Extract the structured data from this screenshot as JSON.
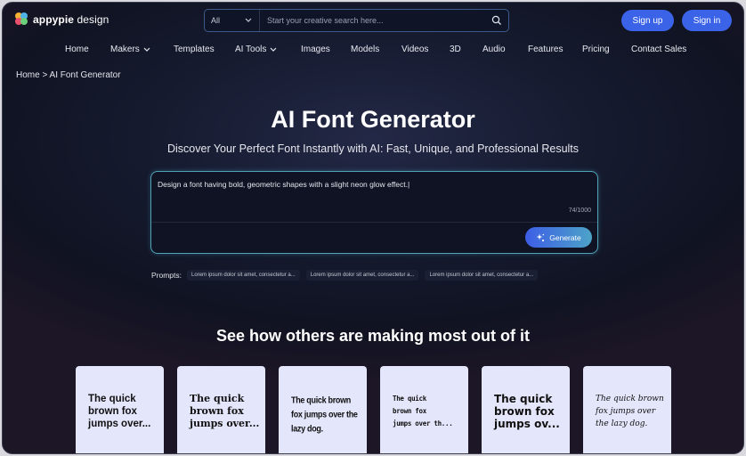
{
  "header": {
    "logo_brand": "appypie",
    "logo_suffix": " design",
    "search": {
      "category": "All",
      "placeholder": "Start your creative search here..."
    },
    "signup_label": "Sign up",
    "signin_label": "Sign in"
  },
  "nav": {
    "items": [
      {
        "label": "Home"
      },
      {
        "label": "Makers"
      },
      {
        "label": "Templates"
      },
      {
        "label": "AI Tools"
      },
      {
        "label": "Images"
      },
      {
        "label": "Models"
      },
      {
        "label": "Videos"
      },
      {
        "label": "3D"
      },
      {
        "label": "Audio"
      },
      {
        "label": "Features"
      },
      {
        "label": "Pricing"
      },
      {
        "label": "Contact Sales"
      }
    ]
  },
  "breadcrumb": "Home > AI Font Generator",
  "hero": {
    "title": "AI Font Generator",
    "subtitle": "Discover Your Perfect Font Instantly with AI: Fast, Unique, and Professional Results"
  },
  "prompt": {
    "value": "Design a font having bold, geometric shapes with a slight neon glow effect.|",
    "counter": "74/1000",
    "generate_label": "Generate"
  },
  "prompts": {
    "label": "Prompts:",
    "chips": [
      "Lorem ipsum dolor sit amet, consectetur a...",
      "Lorem ipsum dolor sit amet, consectetur a...",
      "Lorem ipsum dolor sit amet, consectetur a..."
    ]
  },
  "showcase": {
    "title": "See how others are making most out of it",
    "cards": [
      {
        "text": "The quick\nbrown fox\njumps over..."
      },
      {
        "text": "The quick\nbrown fox\njumps over..."
      },
      {
        "text": "The quick brown\nfox jumps over the\nlazy dog."
      },
      {
        "text": "The quick\nbrown fox\njumps over th..."
      },
      {
        "text": "The quick\nbrown fox\njumps ov..."
      },
      {
        "text": "The quick brown\nfox jumps over\nthe lazy dog."
      }
    ]
  },
  "colors": {
    "accent": "#3b63e8",
    "card_bg": "#e4e6fb"
  }
}
